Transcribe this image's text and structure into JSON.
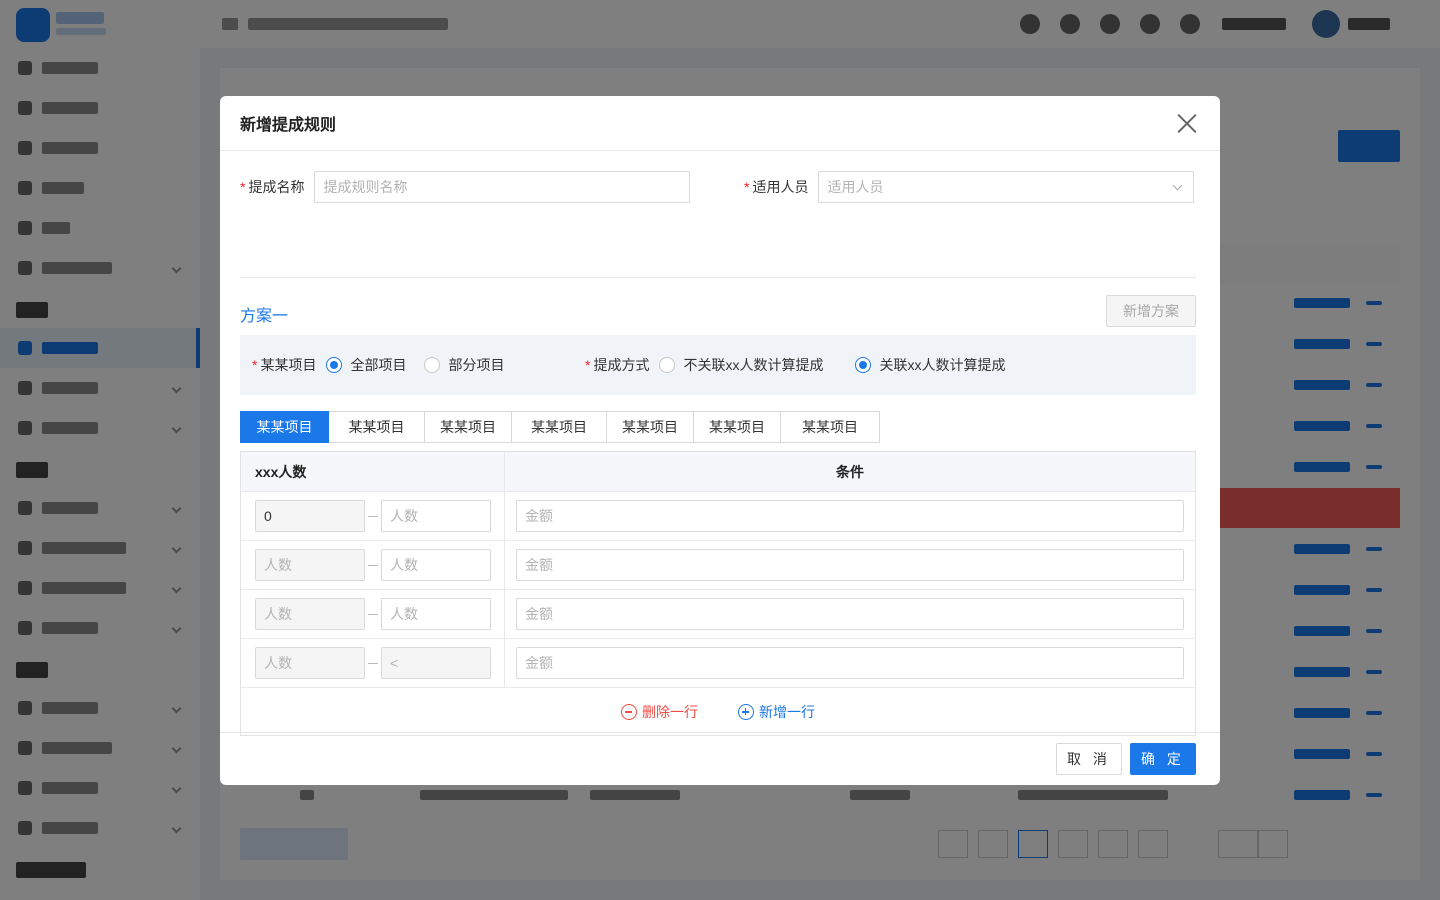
{
  "modal": {
    "title": "新增提成规则",
    "commission_name": {
      "label": "提成名称",
      "placeholder": "提成规则名称",
      "value": ""
    },
    "applicable_staff": {
      "label": "适用人员",
      "placeholder": "适用人员"
    },
    "scheme": {
      "title": "方案一",
      "add_button": "新增方案",
      "project": {
        "label": "某某项目",
        "options": [
          "全部项目",
          "部分项目"
        ],
        "selected": "全部项目"
      },
      "method": {
        "label": "提成方式",
        "options": [
          "不关联xx人数计算提成",
          "关联xx人数计算提成"
        ],
        "selected": "关联xx人数计算提成"
      }
    },
    "tabs": [
      "某某项目",
      "某某项目",
      "某某项目",
      "某某项目",
      "某某项目",
      "某某项目",
      "某某项目"
    ],
    "active_tab": 0,
    "table": {
      "headers": [
        "xxx人数",
        "条件"
      ],
      "rows": [
        {
          "from": "0",
          "from_placeholder": "",
          "to": "",
          "to_placeholder": "人数",
          "amount_placeholder": "金额"
        },
        {
          "from": "",
          "from_placeholder": "人数",
          "to": "",
          "to_placeholder": "人数",
          "amount_placeholder": "金额"
        },
        {
          "from": "",
          "from_placeholder": "人数",
          "to": "",
          "to_placeholder": "人数",
          "amount_placeholder": "金额"
        },
        {
          "from": "",
          "from_placeholder": "人数",
          "to": "",
          "to_placeholder": "<",
          "amount_placeholder": "金额"
        }
      ],
      "delete_row": "删除一行",
      "add_row": "新增一行"
    },
    "footer": {
      "cancel": "取 消",
      "confirm": "确 定"
    }
  },
  "colors": {
    "primary": "#1b78e8",
    "danger": "#f04b45",
    "required": "#f5222d"
  },
  "icons": {
    "close": "close-icon",
    "delete": "minus-circle-icon",
    "add": "plus-circle-icon",
    "dropdown": "chevron-down-icon"
  }
}
